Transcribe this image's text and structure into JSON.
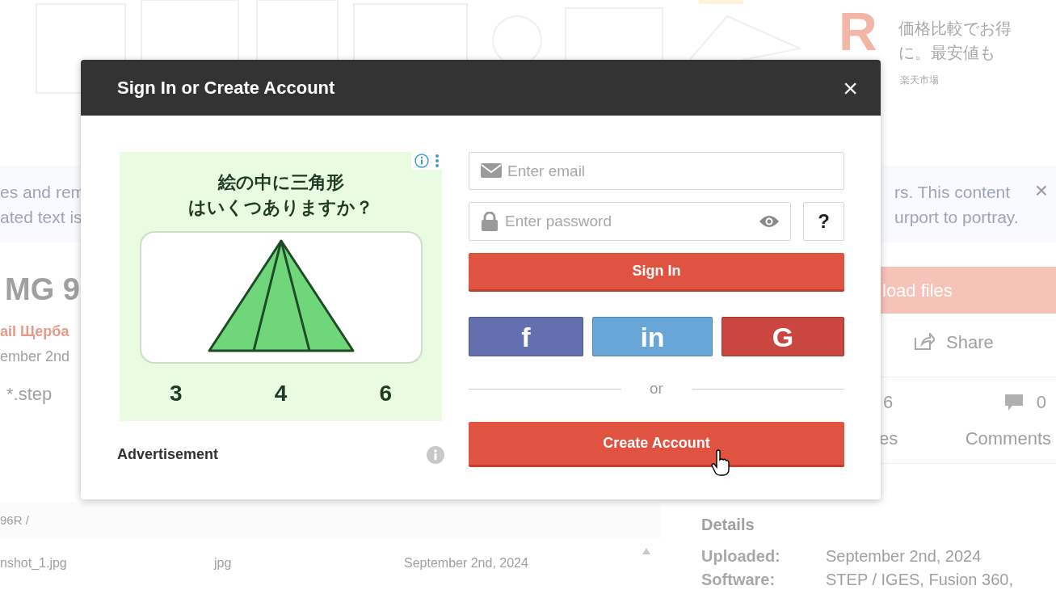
{
  "top_ad": {
    "logo": "R",
    "text": "価格比較でお得に。最安値も",
    "source": "楽天市場"
  },
  "notice": {
    "left_lines": [
      "es and rem",
      "ated text is"
    ],
    "right_lines": [
      "rs. This content",
      "urport to portray."
    ],
    "close": "×"
  },
  "model": {
    "title": "MG 9",
    "author": "ail Щерба",
    "date": "ember 2nd",
    "format": "*.step"
  },
  "actions": {
    "download": "load files",
    "share": "Share"
  },
  "stats": [
    {
      "count": "6",
      "label": "es"
    },
    {
      "count": "0",
      "label": "Comments"
    }
  ],
  "files": {
    "path": "96R /",
    "rows": [
      {
        "name": "nshot_1.jpg",
        "type": "jpg",
        "date": "September 2nd, 2024"
      }
    ]
  },
  "details": {
    "heading": "Details",
    "rows": [
      {
        "label": "Uploaded:",
        "value": "September 2nd, 2024"
      },
      {
        "label": "Software:",
        "value": "STEP / IGES, Fusion 360,"
      }
    ]
  },
  "modal": {
    "title": "Sign In or Create Account",
    "close": "×",
    "ad": {
      "question": [
        "絵の中に三角形",
        "はいくつありますか？"
      ],
      "choices": [
        "3",
        "4",
        "6"
      ],
      "label": "Advertisement"
    },
    "email_placeholder": "Enter email",
    "password_placeholder": "Enter password",
    "help": "?",
    "sign_in": "Sign In",
    "social": [
      {
        "kind": "facebook",
        "label": "f",
        "color": "#6270b0"
      },
      {
        "kind": "linkedin",
        "label": "in",
        "color": "#68a6d8"
      },
      {
        "kind": "google",
        "label": "G",
        "color": "#c9473f"
      }
    ],
    "or": "or",
    "create": "Create Account"
  }
}
